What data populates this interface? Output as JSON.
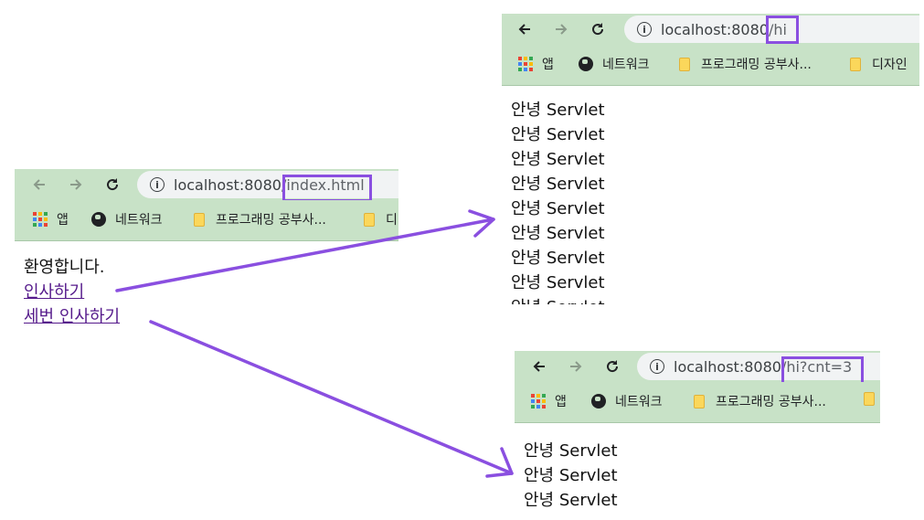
{
  "windows": {
    "index": {
      "host": "localhost:8080",
      "path": "/index.html",
      "bookmarks": [
        "앱",
        "네트워크",
        "프로그래밍 공부사...",
        "디"
      ],
      "welcome": "환영합니다.",
      "links": [
        "인사하기",
        "세번 인사하기"
      ]
    },
    "hi": {
      "host": "localhost:8080",
      "path": "/hi",
      "bookmarks": [
        "앱",
        "네트워크",
        "프로그래밍 공부사...",
        "디자인"
      ],
      "lines": [
        "안녕 Servlet",
        "안녕 Servlet",
        "안녕 Servlet",
        "안녕 Servlet",
        "안녕 Servlet",
        "안녕 Servlet",
        "안녕 Servlet",
        "안녕 Servlet",
        "안녕 Servlet"
      ]
    },
    "hi_cnt": {
      "host": "localhost:8080",
      "path": "/hi?cnt=3",
      "bookmarks": [
        "앱",
        "네트워크",
        "프로그래밍 공부사..."
      ],
      "lines": [
        "안녕 Servlet",
        "안녕 Servlet",
        "안녕 Servlet"
      ]
    }
  },
  "colors": {
    "toolbar": "#c8e2c7",
    "highlight": "#8a4fe0",
    "link": "#551a8b"
  },
  "icons": [
    "back-arrow-icon",
    "forward-arrow-icon",
    "reload-icon",
    "info-icon",
    "apps-grid-icon",
    "globe-icon",
    "folder-icon"
  ]
}
